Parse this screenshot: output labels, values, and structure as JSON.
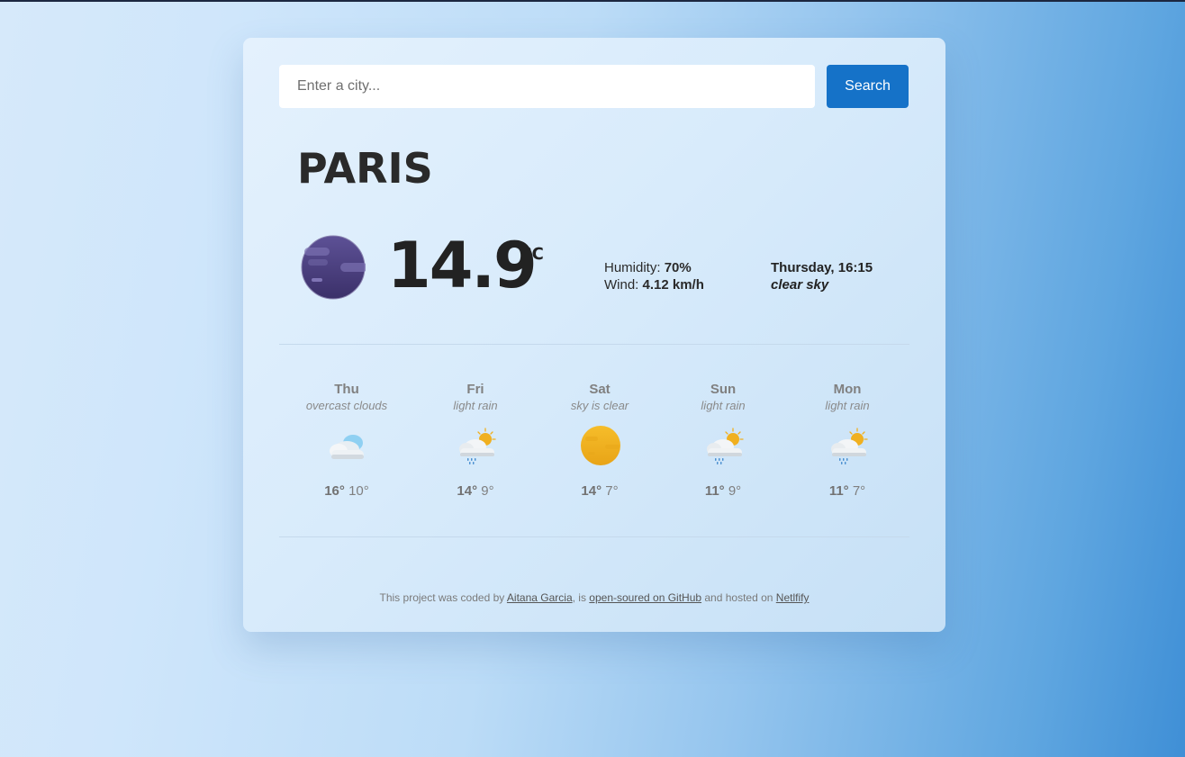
{
  "search": {
    "placeholder": "Enter a city...",
    "button_label": "Search"
  },
  "current": {
    "city": "PARIS",
    "icon": "clear-night-moon-icon",
    "temperature": "14.9",
    "unit": "℃",
    "humidity_label": "Humidity:",
    "humidity_value": "70%",
    "wind_label": "Wind:",
    "wind_value": "4.12 km/h",
    "datetime": "Thursday, 16:15",
    "description": "clear sky"
  },
  "forecast": [
    {
      "day": "Thu",
      "description": "overcast clouds",
      "icon": "overcast-clouds-icon",
      "max": "16°",
      "min": "10°"
    },
    {
      "day": "Fri",
      "description": "light rain",
      "icon": "sun-cloud-rain-icon",
      "max": "14°",
      "min": "9°"
    },
    {
      "day": "Sat",
      "description": "sky is clear",
      "icon": "sun-icon",
      "max": "14°",
      "min": "7°"
    },
    {
      "day": "Sun",
      "description": "light rain",
      "icon": "sun-cloud-rain-icon",
      "max": "11°",
      "min": "9°"
    },
    {
      "day": "Mon",
      "description": "light rain",
      "icon": "sun-cloud-rain-icon",
      "max": "11°",
      "min": "7°"
    }
  ],
  "footer": {
    "text_1": "This project was coded by ",
    "author": "Aitana Garcia",
    "text_2": ", is ",
    "repo_link": "open-soured on GitHub",
    "text_3": " and hosted on ",
    "host_link": "Netlfify"
  },
  "colors": {
    "accent": "#1572c8",
    "text_dark": "#222222",
    "moon": "#4a3f80",
    "sun": "#f0b020"
  }
}
